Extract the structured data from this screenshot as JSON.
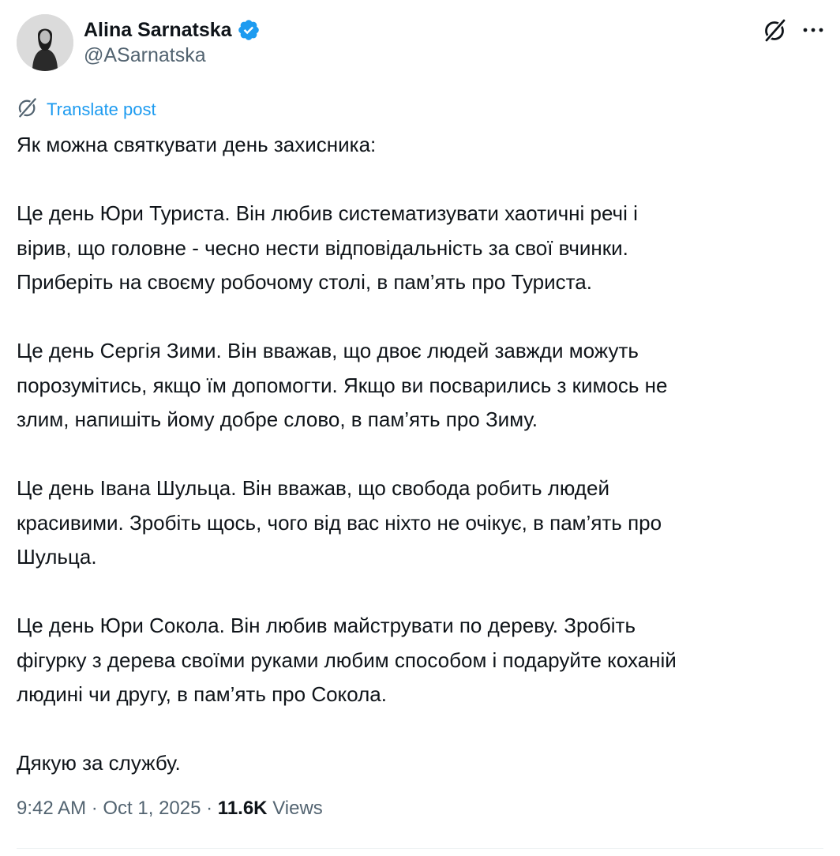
{
  "author": {
    "display_name": "Alina Sarnatska",
    "handle": "@ASarnatska",
    "verified": true
  },
  "icons": {
    "verified": "verified-badge-icon",
    "grok": "grok-icon",
    "more": "more-options-icon",
    "translate": "grok-translate-icon"
  },
  "colors": {
    "accent": "#1d9bf0",
    "text": "#0f1419",
    "secondary": "#536471"
  },
  "translate_label": "Translate post",
  "post_lines": [
    "Як можна святкувати день захисника:",
    "",
    "Це день Юри Туриста. Він любив систематизувати хаотичні речі і",
    "вірив, що головне - чесно нести відповідальність за свої вчинки.",
    "Приберіть на своєму робочому столі, в пам’ять про Туриста.",
    "",
    "Це день Сергія Зими. Він вважав, що двоє людей завжди можуть",
    "порозумітись, якщо їм допомогти. Якщо ви посварились з кимось не",
    "злим, напишіть йому добре слово, в пам’ять про Зиму.",
    "",
    "Це день Івана Шульца. Він вважав, що свобода робить людей",
    "красивими. Зробіть щось, чого від вас ніхто не очікує, в пам’ять про",
    "Шульца.",
    "",
    "Це день Юри Сокола. Він любив майструвати по дереву. Зробіть",
    "фігурку з дерева своїми руками любим способом і подаруйте коханій",
    "людині чи другу, в пам’ять про Сокола.",
    "",
    "Дякую за службу."
  ],
  "meta": {
    "time": "9:42 AM",
    "separator": " · ",
    "date": "Oct 1, 2025",
    "views_count": "11.6K",
    "views_label": "Views"
  }
}
